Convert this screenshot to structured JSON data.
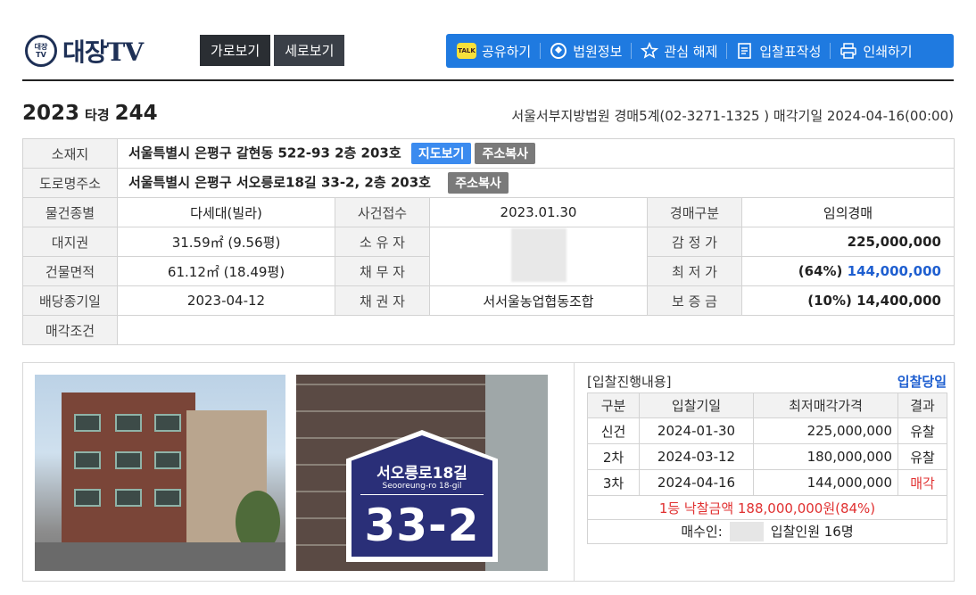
{
  "header": {
    "logo_badge_top": "대장",
    "logo_badge_bottom": "TV",
    "logo_text": "대장TV",
    "view_buttons": [
      "가로보기",
      "세로보기"
    ],
    "toolbar": [
      {
        "label": "공유하기",
        "icon": "kakaotalk-icon",
        "icon_text": "TALK"
      },
      {
        "label": "법원정보",
        "icon": "court-icon"
      },
      {
        "label": "관심 해제",
        "icon": "star-icon"
      },
      {
        "label": "입찰표작성",
        "icon": "document-icon"
      },
      {
        "label": "인쇄하기",
        "icon": "printer-icon"
      }
    ]
  },
  "case": {
    "year": "2023",
    "type": "타경",
    "number": "244",
    "court_info": "서울서부지방법원 경매5계(02-3271-1325 ) 매각기일 2024-04-16(00:00)"
  },
  "info": {
    "location_label": "소재지",
    "location": "서울특별시 은평구 갈현동 522-93 2층 203호",
    "map_button": "지도보기",
    "copy_button": "주소복사",
    "road_label": "도로명주소",
    "road_address": "서울특별시 은평구 서오릉로18길 33-2, 2층 203호",
    "rows": [
      {
        "l1": "물건종별",
        "v1": "다세대(빌라)",
        "l2": "사건접수",
        "v2": "2023.01.30",
        "l3": "경매구분",
        "v3": "임의경매"
      },
      {
        "l1": "대지권",
        "v1": "31.59㎡ (9.56평)",
        "l2": "소 유 자",
        "v2": "",
        "l3": "감 정 가",
        "v3": "225,000,000"
      },
      {
        "l1": "건물면적",
        "v1": "61.12㎡ (18.49평)",
        "l2": "채 무 자",
        "v2": "",
        "l3": "최 저 가",
        "v3_pct": "(64%)",
        "v3": "144,000,000"
      },
      {
        "l1": "배당종기일",
        "v1": "2023-04-12",
        "l2": "채 권 자",
        "v2": "서서울농업협동조합",
        "l3": "보 증 금",
        "v3": "(10%) 14,400,000"
      }
    ],
    "sale_condition_label": "매각조건",
    "sale_condition": ""
  },
  "sign": {
    "korean": "서오릉로18길",
    "english": "Seooreung-ro 18-gil",
    "number": "33-2"
  },
  "bid": {
    "title": "[입찰진행내용]",
    "today_link": "입찰당일",
    "headers": [
      "구분",
      "입찰기일",
      "최저매각가격",
      "결과"
    ],
    "rows": [
      {
        "round": "신건",
        "date": "2024-01-30",
        "price": "225,000,000",
        "result": "유찰"
      },
      {
        "round": "2차",
        "date": "2024-03-12",
        "price": "180,000,000",
        "result": "유찰"
      },
      {
        "round": "3차",
        "date": "2024-04-16",
        "price": "144,000,000",
        "result": "매각"
      }
    ],
    "sold_line": "1등 낙찰금액 188,000,000원(84%)",
    "buyer_label": "매수인:",
    "bidders": "입찰인원 16명"
  }
}
